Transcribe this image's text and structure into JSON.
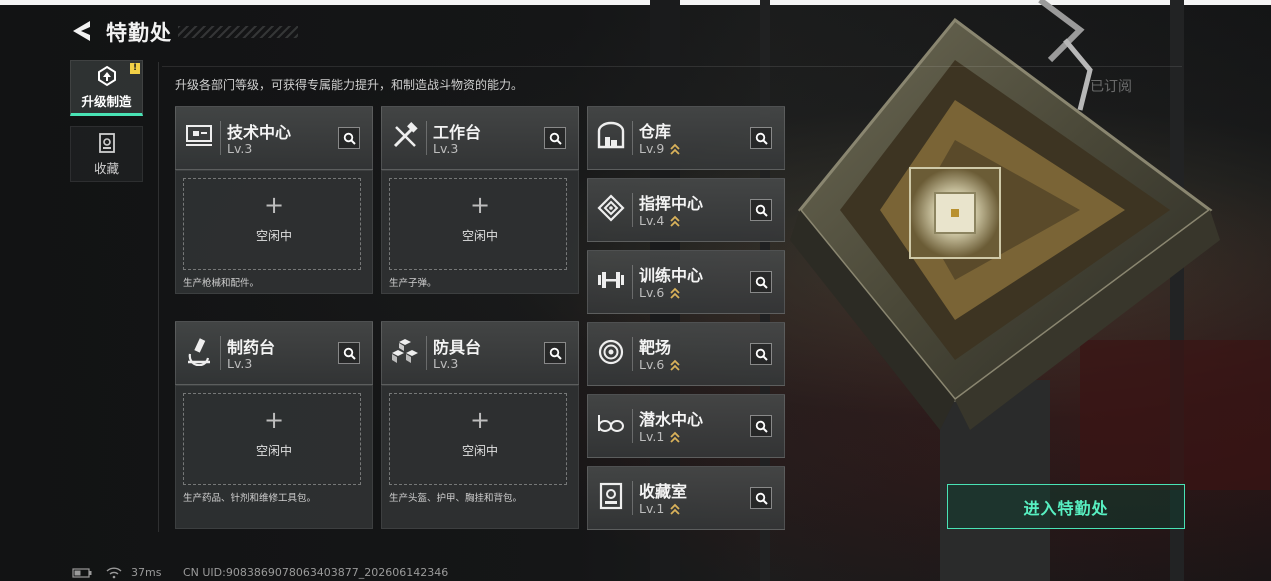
{
  "header": {
    "title": "特勤处"
  },
  "nav": [
    {
      "label": "升级制造",
      "active": true,
      "badge": "!"
    },
    {
      "label": "收藏",
      "active": false
    }
  ],
  "description": "升级各部门等级，可获得专属能力提升，和制造战斗物资的能力。",
  "production_cards": [
    {
      "name": "技术中心",
      "level": "Lv.3",
      "icon": "computer-icon",
      "slot_status": "空闲中",
      "slot_desc": "生产枪械和配件。"
    },
    {
      "name": "工作台",
      "level": "Lv.3",
      "icon": "tools-icon",
      "slot_status": "空闲中",
      "slot_desc": "生产子弹。"
    },
    {
      "name": "制药台",
      "level": "Lv.3",
      "icon": "microscope-icon",
      "slot_status": "空闲中",
      "slot_desc": "生产药品、针剂和维修工具包。"
    },
    {
      "name": "防具台",
      "level": "Lv.3",
      "icon": "armor-cubes-icon",
      "slot_status": "空闲中",
      "slot_desc": "生产头盔、护甲、胸挂和背包。"
    }
  ],
  "facilities": [
    {
      "name": "仓库",
      "level": "Lv.9",
      "icon": "warehouse-icon"
    },
    {
      "name": "指挥中心",
      "level": "Lv.4",
      "icon": "command-icon"
    },
    {
      "name": "训练中心",
      "level": "Lv.6",
      "icon": "dumbbell-icon"
    },
    {
      "name": "靶场",
      "level": "Lv.6",
      "icon": "target-icon"
    },
    {
      "name": "潜水中心",
      "level": "Lv.1",
      "icon": "goggles-icon"
    },
    {
      "name": "收藏室",
      "level": "Lv.1",
      "icon": "collection-icon"
    }
  ],
  "subscribed_label": "已订阅",
  "enter_button": "进入特勤处",
  "footer": {
    "latency": "37ms",
    "uid": "CN UID:9083869078063403877_202606142346"
  },
  "colors": {
    "accent": "#49e3b5",
    "badge": "#f2d046",
    "level_chevron": "#d9b25a"
  }
}
